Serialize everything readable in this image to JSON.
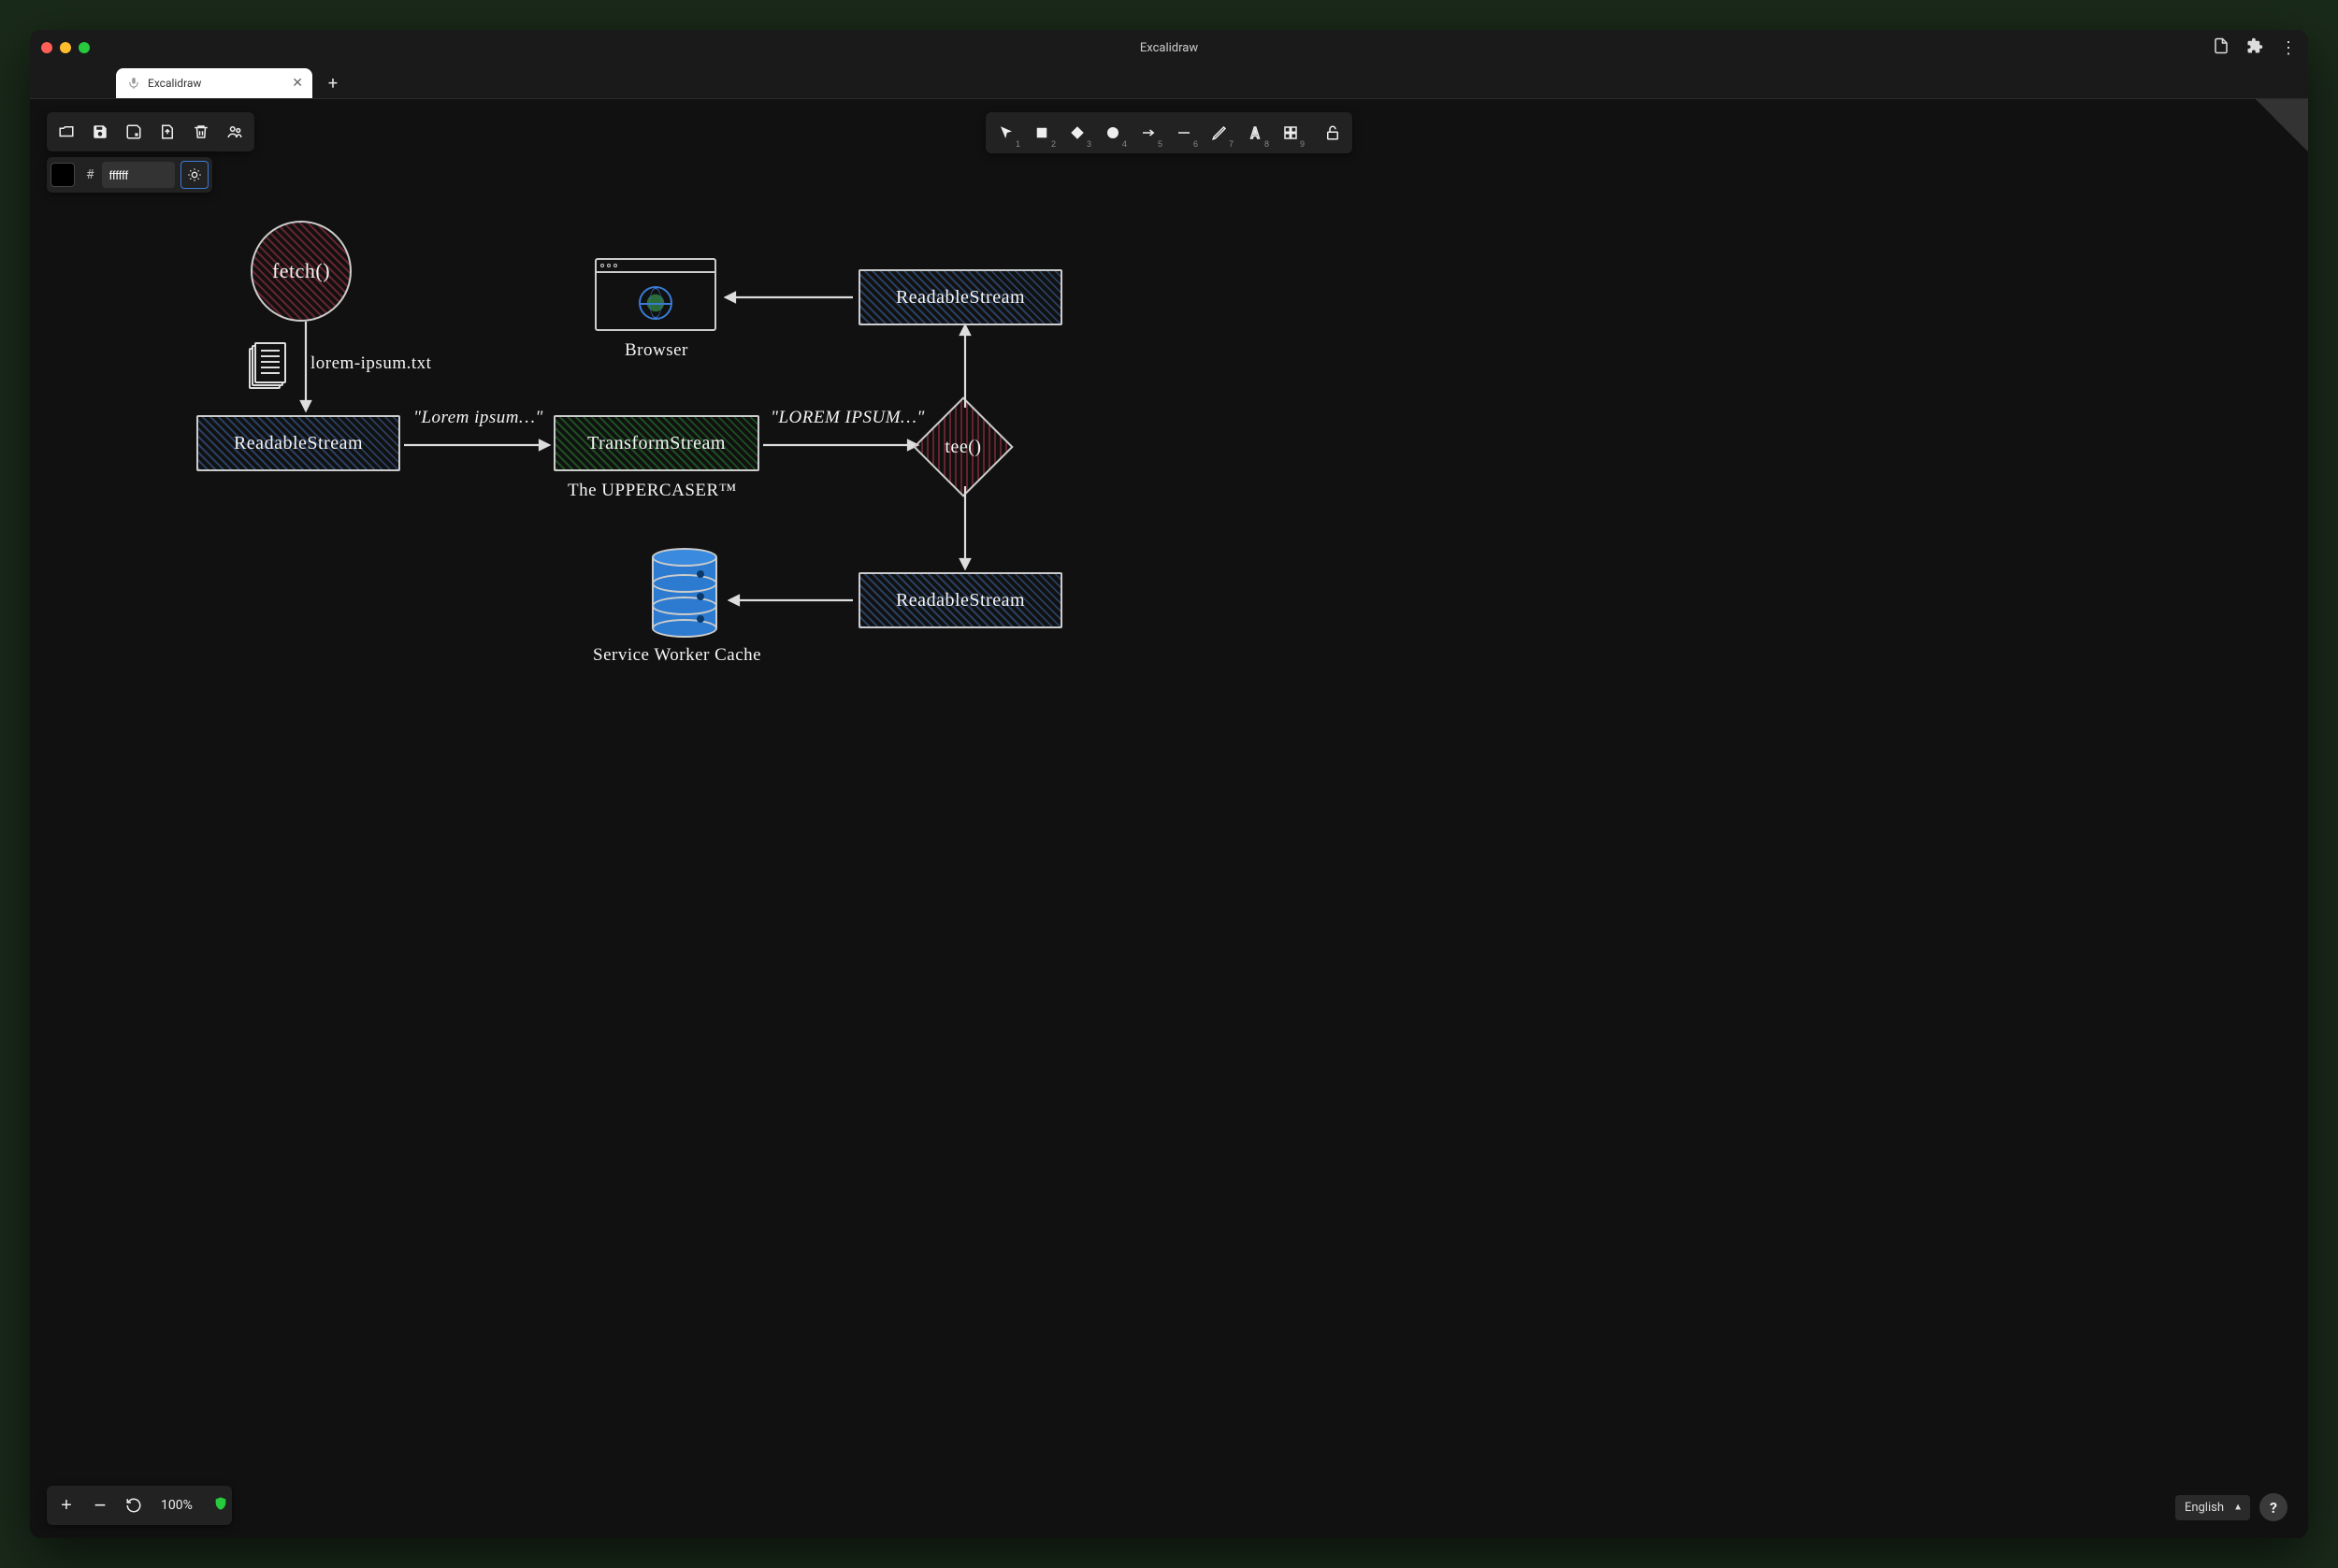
{
  "window": {
    "title": "Excalidraw",
    "tab_name": "Excalidraw"
  },
  "tools": {
    "keys": [
      "1",
      "2",
      "3",
      "4",
      "5",
      "6",
      "7",
      "8",
      "9"
    ]
  },
  "color": {
    "value": "ffffff",
    "prefix": "#"
  },
  "zoom": {
    "label": "100%"
  },
  "language": {
    "selected": "English"
  },
  "diagram": {
    "fetch_label": "fetch()",
    "file_label": "lorem-ipsum.txt",
    "readable1": "ReadableStream",
    "arrow1_label": "\"Lorem ipsum…\"",
    "transform": "TransformStream",
    "transform_sub": "The UPPERCASER™",
    "arrow2_label": "\"LOREM IPSUM…\"",
    "tee": "tee()",
    "readable_top": "ReadableStream",
    "browser_label": "Browser",
    "readable_bottom": "ReadableStream",
    "cache_label": "Service Worker Cache"
  }
}
